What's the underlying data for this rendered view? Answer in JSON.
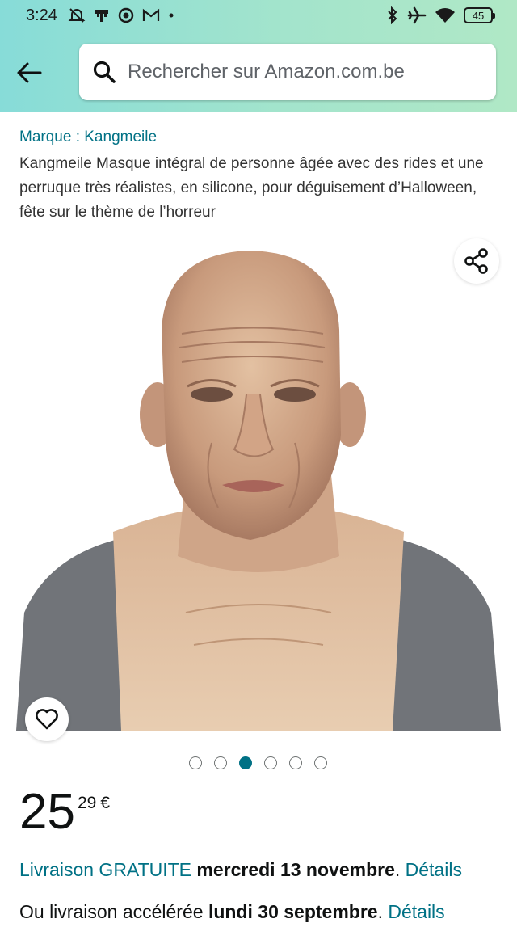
{
  "status_bar": {
    "time": "3:24",
    "battery": "45",
    "left_icons": [
      "mute-alarm-icon",
      "signal-tower-icon",
      "screen-record-icon",
      "gmail-icon",
      "dot-icon"
    ],
    "right_icons": [
      "bluetooth-icon",
      "airplane-mode-icon",
      "wifi-icon",
      "battery-icon"
    ]
  },
  "header": {
    "back_icon": "arrow-left-icon",
    "search_placeholder": "Rechercher sur Amazon.com.be",
    "search_value": "",
    "gradient": [
      "#87dcd8",
      "#b0e8c6"
    ]
  },
  "product": {
    "brand": "Marque : Kangmeile",
    "title": "Kangmeile Masque intégral de personne âgée avec des rides et une perruque très réalistes, en silicone, pour déguisement d’Halloween, fête sur le thème de l’horreur",
    "image_alt": "Masque intégral de personne âgée en silicone",
    "share_icon": "share-icon",
    "wishlist_icon": "heart-outline-icon"
  },
  "carousel": {
    "count": 6,
    "active_index": 2
  },
  "price": {
    "whole": "25",
    "fraction": "29",
    "currency": "€"
  },
  "delivery": {
    "line1": {
      "prefix": "Livraison GRATUITE",
      "date": "mercredi 13 novembre",
      "punct": ".",
      "details": "Détails"
    },
    "line2": {
      "prefix": "Ou livraison accélérée",
      "date": "lundi 30 septembre",
      "punct": ".",
      "details": "Détails"
    }
  },
  "colors": {
    "link": "#007185",
    "text": "#0f1111"
  }
}
